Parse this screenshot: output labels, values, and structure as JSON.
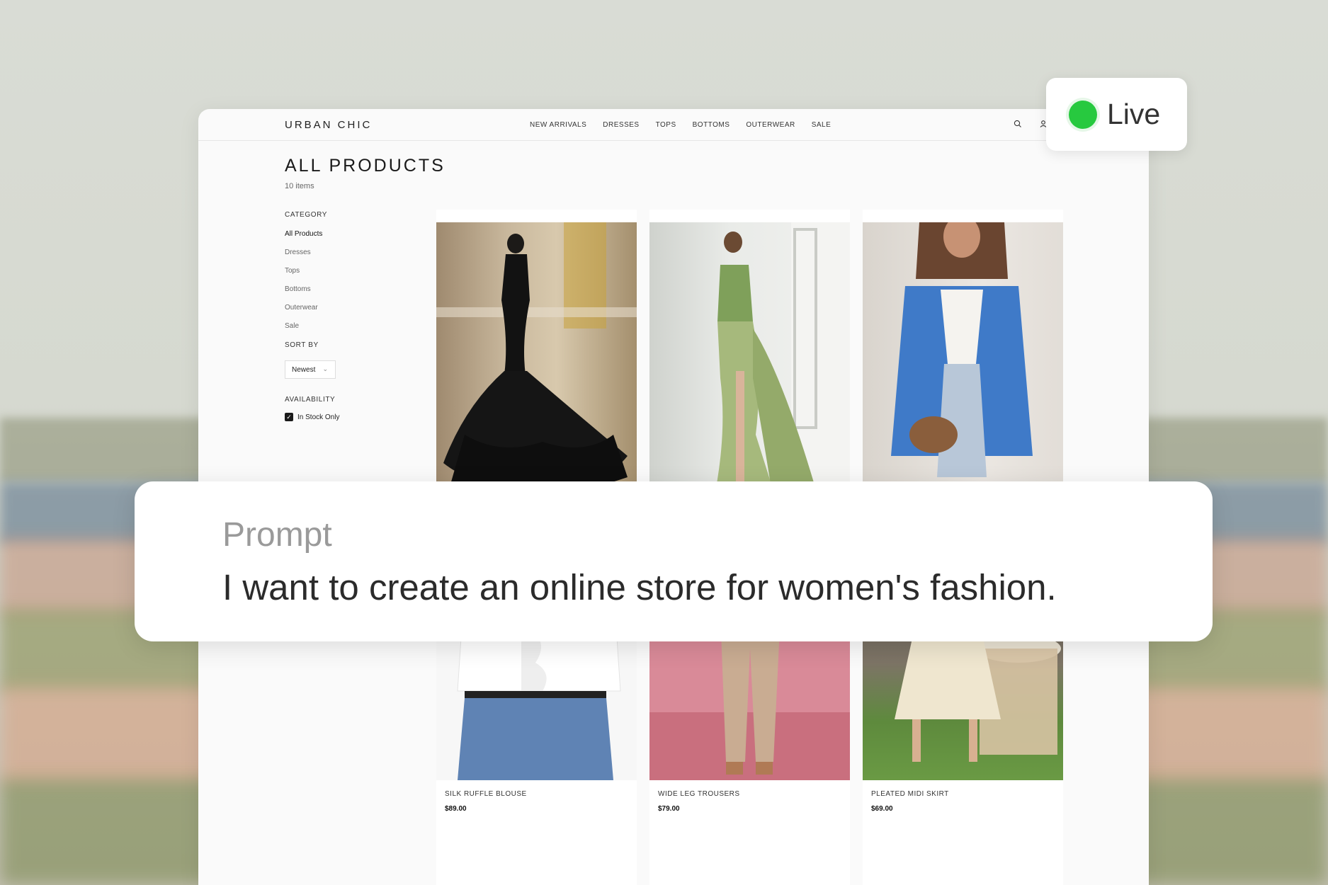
{
  "live_badge": {
    "label": "Live",
    "status_color": "#27c93f"
  },
  "prompt": {
    "label": "Prompt",
    "text": "I want to create an online store for women's fashion."
  },
  "store": {
    "brand": "URBAN CHIC",
    "nav": [
      "NEW ARRIVALS",
      "DRESSES",
      "TOPS",
      "BOTTOMS",
      "OUTERWEAR",
      "SALE"
    ],
    "nav_icons": [
      "search-icon",
      "user-icon"
    ],
    "page_title": "ALL PRODUCTS",
    "item_count": "10 items",
    "sidebar": {
      "category_heading": "CATEGORY",
      "categories": [
        "All Products",
        "Dresses",
        "Tops",
        "Bottoms",
        "Outerwear",
        "Sale"
      ],
      "active_category": "All Products",
      "sort_heading": "SORT BY",
      "sort_value": "Newest",
      "availability_heading": "AVAILABILITY",
      "in_stock_label": "In Stock Only",
      "in_stock_checked": true
    },
    "products": [
      {
        "name": "",
        "price": "",
        "image": "black-feather-gown"
      },
      {
        "name": "",
        "price": "",
        "image": "green-satin-gown"
      },
      {
        "name": "",
        "price": "",
        "image": "blue-blazer"
      },
      {
        "name": "SILK RUFFLE BLOUSE",
        "price": "$89.00",
        "image": "white-ruffle-blouse"
      },
      {
        "name": "WIDE LEG TROUSERS",
        "price": "$79.00",
        "image": "beige-trousers"
      },
      {
        "name": "PLEATED MIDI SKIRT",
        "price": "$69.00",
        "image": "cream-midi-skirt"
      }
    ]
  }
}
